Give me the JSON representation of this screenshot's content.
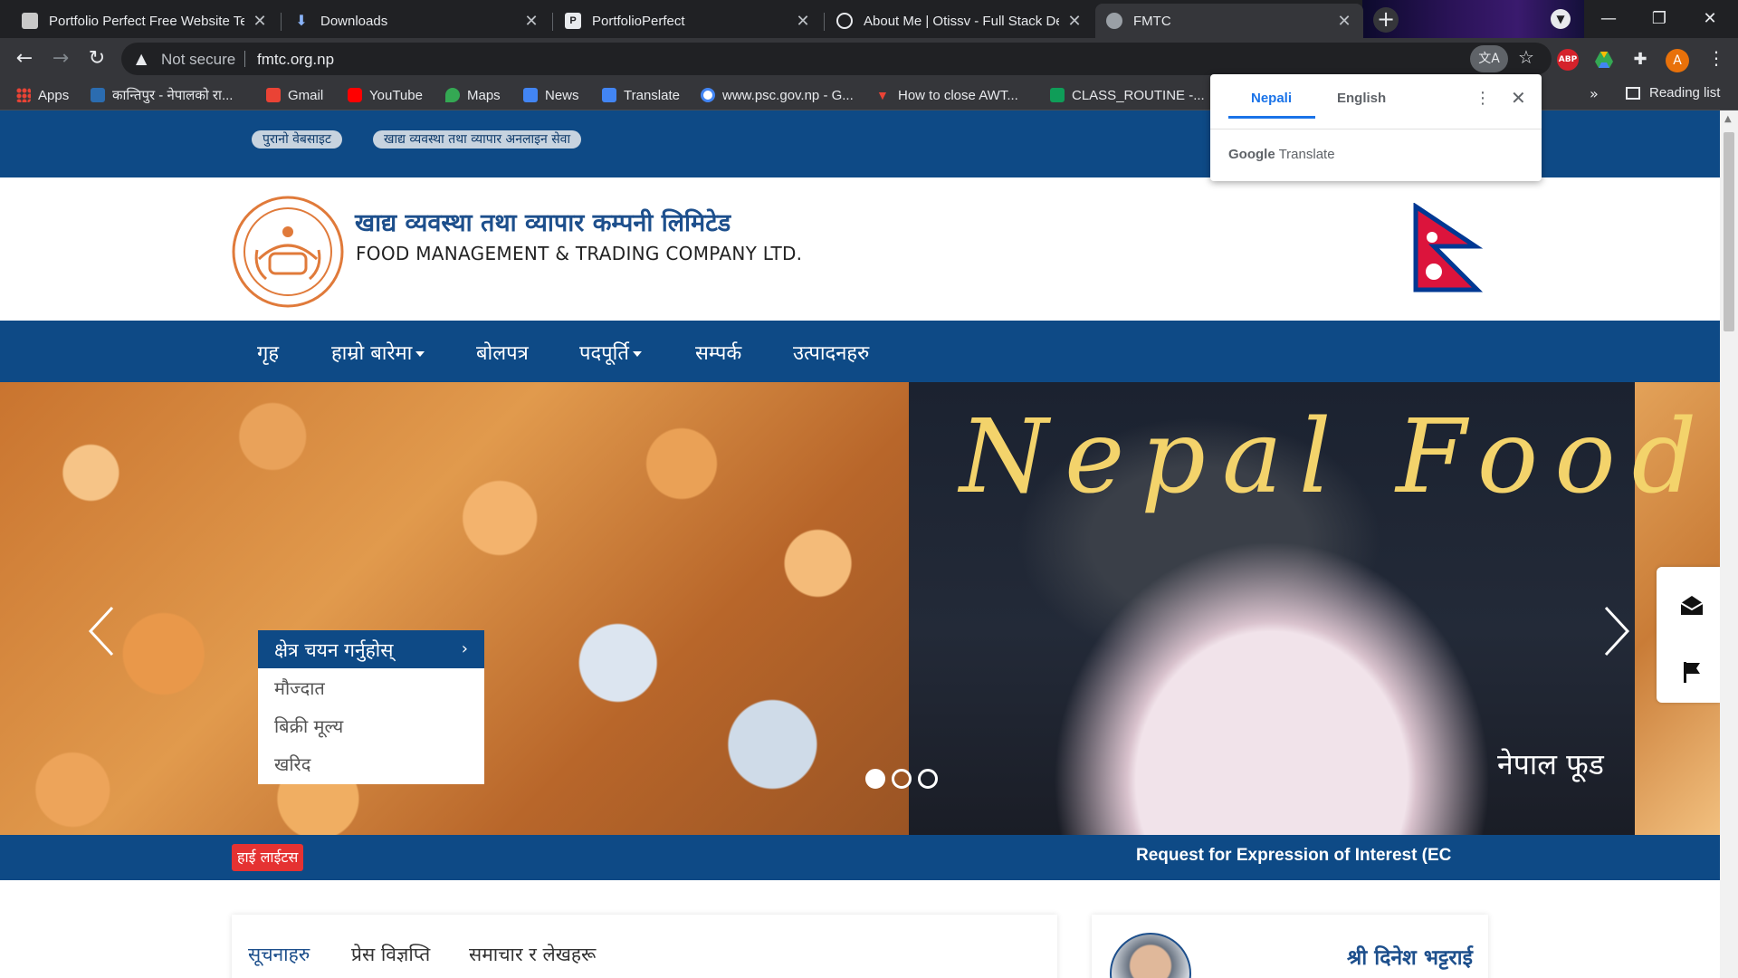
{
  "browser": {
    "tabs": [
      {
        "title": "Portfolio Perfect Free Website Te",
        "favicon": "portfolio-favicon",
        "active": false
      },
      {
        "title": "Downloads",
        "favicon": "download-icon",
        "active": false
      },
      {
        "title": "PortfolioPerfect",
        "favicon": "pp-favicon",
        "active": false
      },
      {
        "title": "About Me | Otissv - Full Stack De",
        "favicon": "globe-icon",
        "active": false
      },
      {
        "title": "FMTC",
        "favicon": "fmtc-favicon",
        "active": true
      }
    ],
    "security_label": "Not secure",
    "url": "fmtc.org.np",
    "avatar_letter": "A",
    "extensions": [
      "ABP",
      "drive-icon",
      "puzzle-icon"
    ],
    "bookmarks": [
      {
        "label": "Apps",
        "icon": "apps-grid-icon"
      },
      {
        "label": "कान्तिपुर - नेपालको रा...",
        "icon": "kantipur-favicon"
      },
      {
        "label": "Gmail",
        "icon": "gmail-icon"
      },
      {
        "label": "YouTube",
        "icon": "youtube-icon"
      },
      {
        "label": "Maps",
        "icon": "maps-icon"
      },
      {
        "label": "News",
        "icon": "news-icon"
      },
      {
        "label": "Translate",
        "icon": "translate-icon"
      },
      {
        "label": "www.psc.gov.np - G...",
        "icon": "google-icon"
      },
      {
        "label": "How to close AWT...",
        "icon": "v-favicon"
      },
      {
        "label": "CLASS_ROUTINE -...",
        "icon": "sheets-icon"
      }
    ],
    "bookmarks_more": "»",
    "reading_list": "Reading list"
  },
  "translate_popup": {
    "tab_source": "Nepali",
    "tab_target": "English",
    "brand_google": "Google",
    "brand_translate": "Translate"
  },
  "site": {
    "top_links": [
      "पुरानो वेबसाइट",
      "खाद्य व्यवस्था तथा व्यापार अनलाइन सेवा"
    ],
    "title_np": "खाद्य व्यवस्था तथा व्यापार कम्पनी लिमिटेड",
    "title_en": "FOOD MANAGEMENT & TRADING COMPANY LTD.",
    "nav": [
      {
        "label": "गृह",
        "dropdown": false
      },
      {
        "label": "हाम्रो बारेमा",
        "dropdown": true
      },
      {
        "label": "बोलपत्र",
        "dropdown": false
      },
      {
        "label": "पदपूर्ति",
        "dropdown": true
      },
      {
        "label": "सम्पर्क",
        "dropdown": false
      },
      {
        "label": "उत्पादनहरु",
        "dropdown": false
      }
    ],
    "slider": {
      "banner_text": "Nepal Food",
      "caption": "नेपाल फूड",
      "dots": 3,
      "active_dot": 0
    },
    "sector_select": {
      "header": "क्षेत्र चयन गर्नुहोस्",
      "options": [
        "मौज्दात",
        "बिक्री मूल्य",
        "खरिद"
      ]
    },
    "highlights": {
      "badge": "हाई लाईटस",
      "ticker": "Request for Expression of Interest (EC"
    },
    "news_tabs": [
      "सूचनाहरु",
      "प्रेस विज्ञप्ति",
      "समाचार र लेखहरू"
    ],
    "person_name": "श्री दिनेश भट्टराई"
  },
  "colors": {
    "brand_blue": "#0e4a86",
    "highlight_red": "#e53232",
    "banner_gold": "#f3d36b"
  }
}
